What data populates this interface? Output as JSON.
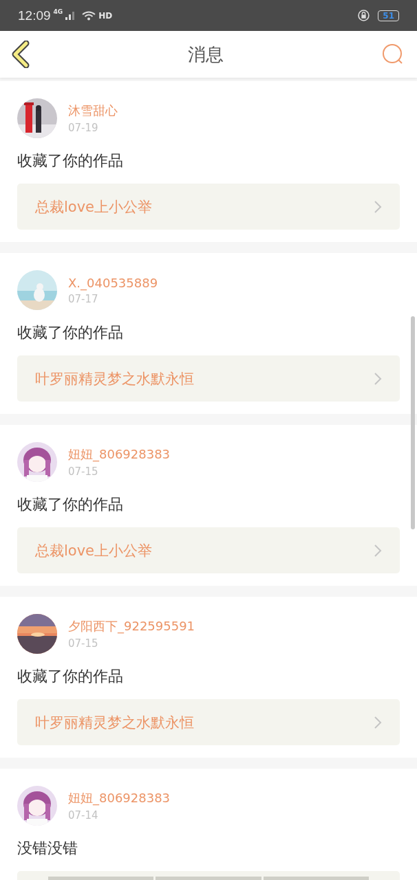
{
  "status_bar": {
    "time": "12:09",
    "network": "4G",
    "hd": "HD",
    "battery": "51"
  },
  "header": {
    "title": "消息"
  },
  "messages": [
    {
      "user": "沐雪甜心",
      "date": "07-19",
      "text": "收藏了你的作品",
      "kind": "work",
      "work": "总裁love上小公举"
    },
    {
      "user": "X._040535889",
      "date": "07-17",
      "text": "收藏了你的作品",
      "kind": "work",
      "work": "叶罗丽精灵梦之水默永恒"
    },
    {
      "user": "妞妞_806928383",
      "date": "07-15",
      "text": "收藏了你的作品",
      "kind": "work",
      "work": "总裁love上小公举"
    },
    {
      "user": "夕阳西下_922595591",
      "date": "07-15",
      "text": "收藏了你的作品",
      "kind": "work",
      "work": "叶罗丽精灵梦之水默永恒"
    },
    {
      "user": "妞妞_806928383",
      "date": "07-14",
      "text": "没错没错",
      "kind": "reply"
    }
  ]
}
